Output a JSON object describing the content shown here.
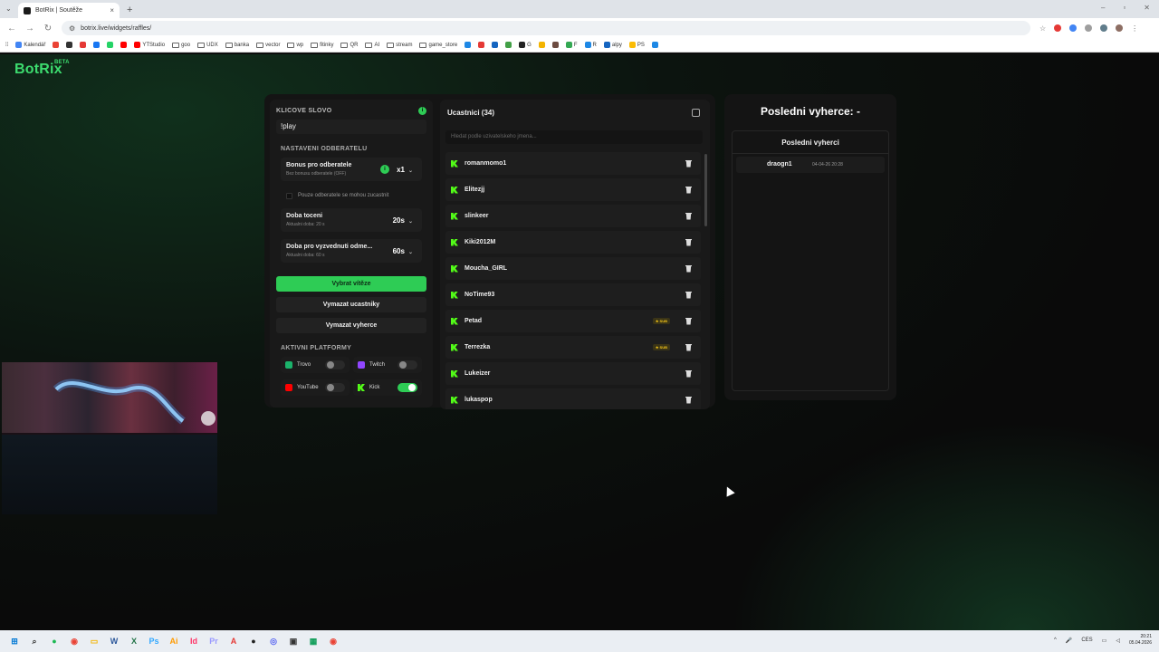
{
  "browser": {
    "tab_title": "BotRix | Soutěže",
    "tab_close": "×",
    "new_tab": "+",
    "tab_menu": "⌄",
    "url": "botrix.live/widgets/raffles/",
    "window_controls": [
      "–",
      "▫",
      "✕"
    ],
    "nav": {
      "back": "←",
      "forward": "→",
      "reload": "↻"
    }
  },
  "bookmarks": [
    {
      "label": "Kalendář",
      "color": "#4285f4"
    },
    {
      "label": "",
      "color": "#ea4335"
    },
    {
      "label": "",
      "color": "#333333"
    },
    {
      "label": "",
      "color": "#e53935"
    },
    {
      "label": "",
      "color": "#1877f2"
    },
    {
      "label": "",
      "color": "#25d366"
    },
    {
      "label": "",
      "color": "#ff0000"
    },
    {
      "label": "YTStudio",
      "color": "#ff0000"
    },
    {
      "label": "goo",
      "folder": true
    },
    {
      "label": "UDX",
      "folder": true
    },
    {
      "label": "banka",
      "folder": true
    },
    {
      "label": "vector",
      "folder": true
    },
    {
      "label": "wp",
      "folder": true
    },
    {
      "label": "fitinky",
      "folder": true
    },
    {
      "label": "QR",
      "folder": true
    },
    {
      "label": "AI",
      "folder": true
    },
    {
      "label": "stream",
      "folder": true
    },
    {
      "label": "game_store",
      "folder": true
    },
    {
      "label": "",
      "color": "#1e88e5"
    },
    {
      "label": "",
      "color": "#e53935"
    },
    {
      "label": "",
      "color": "#1565c0"
    },
    {
      "label": "",
      "color": "#43a047"
    },
    {
      "label": "G",
      "color": "#222222"
    },
    {
      "label": "",
      "color": "#f4b400"
    },
    {
      "label": "",
      "color": "#6d4c41"
    },
    {
      "label": "F",
      "color": "#34a853"
    },
    {
      "label": "R",
      "color": "#1e88e5"
    },
    {
      "label": "alpy",
      "color": "#1565c0"
    },
    {
      "label": "PS",
      "color": "#fbbc05"
    },
    {
      "label": "",
      "color": "#1e88e5"
    }
  ],
  "app": {
    "logo": "BotRix",
    "logo_badge": "BETA"
  },
  "settings": {
    "keyword_label": "KLICOVE SLOVO",
    "info_glyph": "i",
    "keyword_value": "!play",
    "subscribers_title": "NASTAVENI ODBERATELU",
    "bonus": {
      "title": "Bonus pro odberatele",
      "sub": "Bez bonusu odberatele (OFF)",
      "value": "x1",
      "chevron": "⌄"
    },
    "subs_only": "Pouze odberatele se mohou zucastnit",
    "spin_time": {
      "title": "Doba toceni",
      "sub": "Aktualni doba: 20 s",
      "value": "20s",
      "chevron": "⌄"
    },
    "claim_time": {
      "title": "Doba pro vyzvednuti odme...",
      "sub": "Aktualni doba: 60 s",
      "value": "60s",
      "chevron": "⌄"
    },
    "buttons": {
      "pick": "Vybrat vítěze",
      "clear_participants": "Vymazat ucastniky",
      "clear_winners": "Vymazat vyherce"
    },
    "platforms_title": "AKTIVNI PLATFORMY",
    "platforms": [
      {
        "name": "Trovo",
        "color": "#1bb36b",
        "on": false
      },
      {
        "name": "Twitch",
        "color": "#9146ff",
        "on": false
      },
      {
        "name": "YouTube",
        "color": "#ff0000",
        "on": false
      },
      {
        "name": "Kick",
        "color": "#53fc18",
        "on": true
      }
    ]
  },
  "participants": {
    "title": "Ucastnici (34)",
    "search_placeholder": "Hledat podle uzivatelskeho jmena...",
    "list": [
      {
        "name": "romanmomo1",
        "sub": ""
      },
      {
        "name": "Elitezjj",
        "sub": ""
      },
      {
        "name": "slinkeer",
        "sub": ""
      },
      {
        "name": "Kiki2012M",
        "sub": ""
      },
      {
        "name": "Moucha_GIRL",
        "sub": ""
      },
      {
        "name": "NoTime93",
        "sub": ""
      },
      {
        "name": "Petad",
        "sub": "★ SUB"
      },
      {
        "name": "Terrezka",
        "sub": "★ SUB"
      },
      {
        "name": "Lukeizer",
        "sub": ""
      },
      {
        "name": "lukaspop",
        "sub": ""
      }
    ]
  },
  "winners": {
    "title": "Posledni vyherce: -",
    "box_title": "Posledni vyherci",
    "rows": [
      {
        "name": "draogn1",
        "time": "04-04-26 20:28"
      }
    ]
  },
  "taskbar": {
    "apps": [
      {
        "glyph": "⊞",
        "color": "#0078d4"
      },
      {
        "glyph": "⌕",
        "color": "#333333"
      },
      {
        "glyph": "●",
        "color": "#1db954"
      },
      {
        "glyph": "◉",
        "color": "#ea4335"
      },
      {
        "glyph": "▭",
        "color": "#f4b400"
      },
      {
        "glyph": "W",
        "color": "#2b579a"
      },
      {
        "glyph": "X",
        "color": "#217346"
      },
      {
        "glyph": "Ps",
        "color": "#31a8ff"
      },
      {
        "glyph": "Ai",
        "color": "#ff9a00"
      },
      {
        "glyph": "Id",
        "color": "#ff3366"
      },
      {
        "glyph": "Pr",
        "color": "#9999ff"
      },
      {
        "glyph": "A",
        "color": "#e53935"
      },
      {
        "glyph": "●",
        "color": "#222222"
      },
      {
        "glyph": "◎",
        "color": "#5865f2"
      },
      {
        "glyph": "▣",
        "color": "#333333"
      },
      {
        "glyph": "▦",
        "color": "#0f9d58"
      },
      {
        "glyph": "◉",
        "color": "#ea4335"
      }
    ],
    "tray": {
      "lang": "CES",
      "time": "20:21",
      "date": "05.04.2026",
      "arrow": "^"
    }
  },
  "colors": {
    "accent": "#2ecc55",
    "kick": "#53fc18",
    "panel": "#191919",
    "background": "#0d0d0d"
  }
}
